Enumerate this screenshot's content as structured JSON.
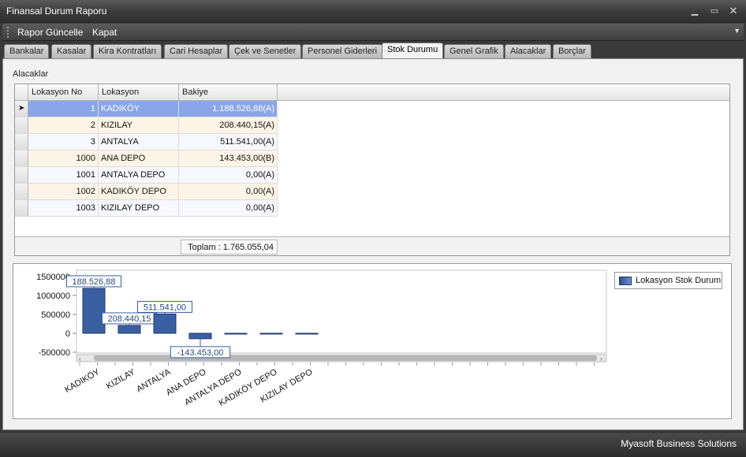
{
  "window": {
    "title": "Finansal Durum Raporu"
  },
  "menu": {
    "items": [
      "Rapor Güncelle",
      "Kapat"
    ]
  },
  "tabs": [
    "Bankalar",
    "Kasalar",
    "Kira Kontratları",
    "Cari Hesaplar",
    "Çek ve Senetler",
    "Personel Giderleri",
    "Stok Durumu",
    "Genel Grafik",
    "Alacaklar",
    "Borçlar"
  ],
  "active_tab": "Stok Durumu",
  "group": {
    "label": "Alacaklar"
  },
  "grid": {
    "columns": [
      "Lokasyon No",
      "Lokasyon",
      "Bakiye"
    ],
    "rows": [
      {
        "no": "1",
        "name": "KADIKÖY",
        "balance": "1.188.526,88(A)"
      },
      {
        "no": "2",
        "name": "KIZILAY",
        "balance": "208.440,15(A)"
      },
      {
        "no": "3",
        "name": "ANTALYA",
        "balance": "511.541,00(A)"
      },
      {
        "no": "1000",
        "name": "ANA DEPO",
        "balance": "143.453,00(B)"
      },
      {
        "no": "1001",
        "name": "ANTALYA DEPO",
        "balance": "0,00(A)"
      },
      {
        "no": "1002",
        "name": "KADIKÖY DEPO",
        "balance": "0,00(A)"
      },
      {
        "no": "1003",
        "name": "KIZILAY DEPO",
        "balance": "0,00(A)"
      }
    ],
    "total": "Toplam : 1.765.055,04"
  },
  "chart_data": {
    "type": "bar",
    "categories": [
      "KADIKÖY",
      "KIZILAY",
      "ANTALYA",
      "ANA DEPO",
      "ANTALYA DEPO",
      "KADIKÖY DEPO",
      "KIZILAY DEPO"
    ],
    "series": [
      {
        "name": "Lokasyon Stok Durum",
        "values": [
          1188526.88,
          208440.15,
          511541.0,
          -143453.0,
          0,
          0,
          0
        ]
      }
    ],
    "data_labels": [
      "188.526,88",
      "208.440,15",
      "511.541,00",
      "-143.453,00",
      "",
      "",
      ""
    ],
    "yticks": [
      "1500000",
      "1000000",
      "500000",
      "0",
      "-500000"
    ],
    "ytick_values": [
      1500000,
      1000000,
      500000,
      0,
      -500000
    ],
    "ylim": [
      -500000,
      1500000
    ],
    "legend": "top-right",
    "grid": false,
    "bar_color": "#3b5fa3"
  },
  "status": {
    "text": "Myasoft Business Solutions"
  }
}
